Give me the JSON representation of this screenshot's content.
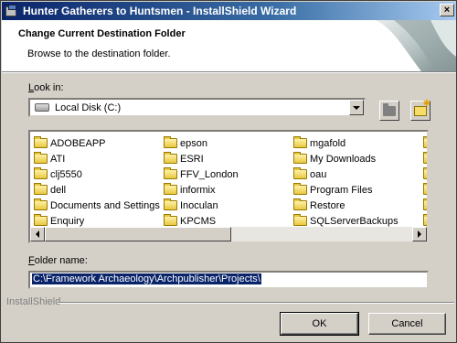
{
  "window": {
    "title": "Hunter Gatherers to Huntsmen - InstallShield Wizard",
    "close_glyph": "×"
  },
  "header": {
    "title": "Change Current Destination Folder",
    "subtitle": "Browse to the destination folder."
  },
  "lookin": {
    "label_prefix": "",
    "label_accel": "L",
    "label_rest": "ook in:",
    "value": "Local Disk (C:)"
  },
  "filelist": {
    "columns": [
      [
        "ADOBEAPP",
        "ATI",
        "clj5550",
        "dell",
        "Documents and Settings",
        "Enquiry"
      ],
      [
        "epson",
        "ESRI",
        "FFV_London",
        "informix",
        "Inoculan",
        "KPCMS"
      ],
      [
        "mgafold",
        "My Downloads",
        "oau",
        "Program Files",
        "Restore",
        "SQLServerBackups"
      ]
    ]
  },
  "folder_name": {
    "label_accel": "F",
    "label_rest": "older name:",
    "value": "C:\\Framework Archaeology\\Archpublisher\\Projects\\"
  },
  "footer": {
    "brand": "InstallShield",
    "ok_label": "OK",
    "cancel_label": "Cancel"
  },
  "colors": {
    "titlebar_start": "#0a246a",
    "titlebar_end": "#a6caf0",
    "face": "#d4d0c8",
    "selection": "#0a246a"
  }
}
